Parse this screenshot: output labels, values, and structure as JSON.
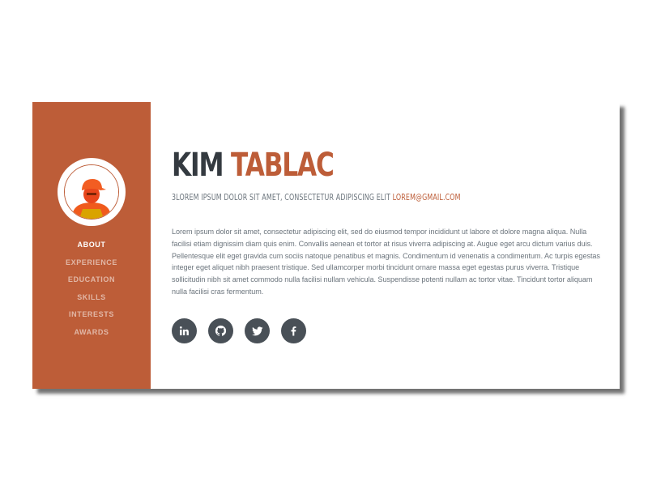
{
  "profile": {
    "first_name": "KIM",
    "last_name": "TABLAC",
    "subheading_text": "3LOREM IPSUM DOLOR SIT AMET, CONSECTETUR ADIPISCING ELIT",
    "email": "LOREM@GMAIL.COM",
    "bio": "Lorem ipsum dolor sit amet, consectetur adipiscing elit, sed do eiusmod tempor incididunt ut labore et dolore magna aliqua. Nulla facilisi etiam dignissim diam quis enim. Convallis aenean et tortor at risus viverra adipiscing at. Augue eget arcu dictum varius duis. Pellentesque elit eget gravida cum sociis natoque penatibus et magnis. Condimentum id venenatis a condimentum. Ac turpis egestas integer eget aliquet nibh praesent tristique. Sed ullamcorper morbi tincidunt ornare massa eget egestas purus viverra. Tristique sollicitudin nibh sit amet commodo nulla facilisi nullam vehicula. Suspendisse potenti nullam ac tortor vitae. Tincidunt tortor aliquam nulla facilisi cras fermentum."
  },
  "sidebar": {
    "items": [
      {
        "label": "ABOUT",
        "active": true
      },
      {
        "label": "EXPERIENCE",
        "active": false
      },
      {
        "label": "EDUCATION",
        "active": false
      },
      {
        "label": "SKILLS",
        "active": false
      },
      {
        "label": "INTERESTS",
        "active": false
      },
      {
        "label": "AWARDS",
        "active": false
      }
    ]
  },
  "social": [
    {
      "icon": "linkedin-icon"
    },
    {
      "icon": "github-icon"
    },
    {
      "icon": "twitter-icon"
    },
    {
      "icon": "facebook-icon"
    }
  ],
  "colors": {
    "accent": "#bd5d38",
    "heading": "#343a40",
    "text": "#6c757d",
    "social_bg": "#495057"
  }
}
